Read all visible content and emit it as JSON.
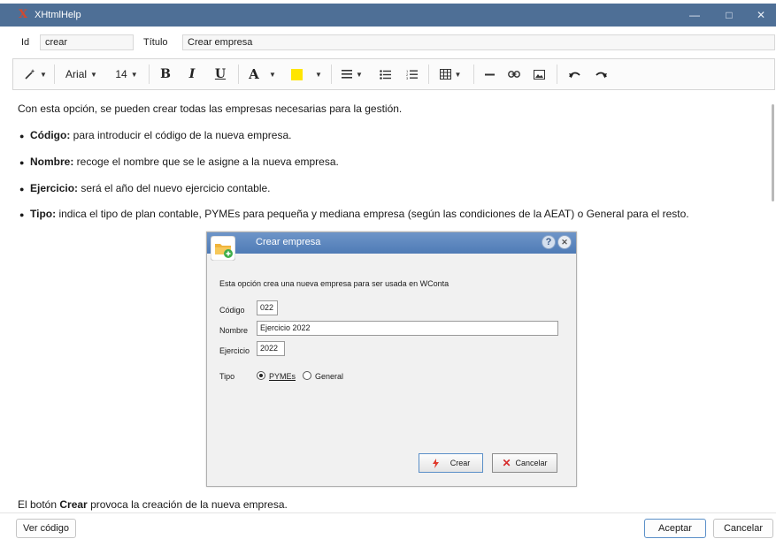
{
  "window": {
    "title": "XHtmlHelp",
    "colors": {
      "titlebar": "#4e6f96",
      "accent": "#5a8fc8"
    }
  },
  "fields": {
    "id_label": "Id",
    "id_value": "crear",
    "title_label": "Título",
    "title_value": "Crear empresa"
  },
  "toolbar": {
    "font": "Arial",
    "size": "14",
    "bold": "B",
    "italic": "I",
    "underline": "U",
    "font_color": "A"
  },
  "content": {
    "intro": "Con esta opción, se pueden crear todas las empresas necesarias para la gestión.",
    "bullets": [
      {
        "bold": "Código:",
        "text": " para introducir el código de la nueva empresa."
      },
      {
        "bold": "Nombre:",
        "text": " recoge el nombre que se le asigne a la nueva empresa."
      },
      {
        "bold": "Ejercicio:",
        "text": " será el año del nuevo ejercicio contable."
      },
      {
        "bold": "Tipo:",
        "text": " indica el tipo de plan contable, PYMEs para pequeña y mediana empresa (según las condiciones de la AEAT) o General para el resto."
      }
    ],
    "outro_pre": "El botón ",
    "outro_bold": "Crear",
    "outro_post": " provoca la creación de la nueva empresa."
  },
  "dialog": {
    "title": "Crear empresa",
    "help_glyph": "?",
    "close_glyph": "✕",
    "description": "Esta opción crea una nueva empresa para ser usada en WConta",
    "codigo_label": "Código",
    "codigo_value": "022",
    "nombre_label": "Nombre",
    "nombre_value": "Ejercicio 2022",
    "ejercicio_label": "Ejercicio",
    "ejercicio_value": "2022",
    "tipo_label": "Tipo",
    "tipo_options": [
      "PYMEs",
      "General"
    ],
    "tipo_selected": "PYMEs",
    "crear_label": "Crear",
    "cancelar_label": "Cancelar"
  },
  "footer": {
    "ver_codigo": "Ver código",
    "aceptar": "Aceptar",
    "cancelar": "Cancelar"
  }
}
